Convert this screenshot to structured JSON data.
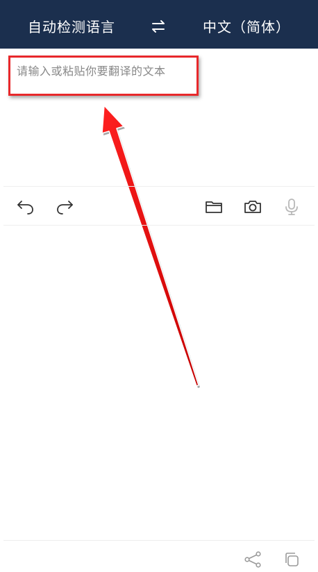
{
  "header": {
    "source_language": "自动检测语言",
    "swap_icon": "swap-arrows-icon",
    "target_language": "中文（简体）",
    "background_color": "#1b2f4e"
  },
  "input": {
    "placeholder": "请输入或粘贴你要翻译的文本"
  },
  "toolbar": {
    "left_icons": [
      "undo-icon",
      "redo-icon"
    ],
    "right_icons": [
      "folder-icon",
      "camera-icon",
      "microphone-icon"
    ]
  },
  "bottom_bar": {
    "icons": [
      "share-icon",
      "copy-icon"
    ]
  },
  "annotation": {
    "color": "#e8282b"
  }
}
